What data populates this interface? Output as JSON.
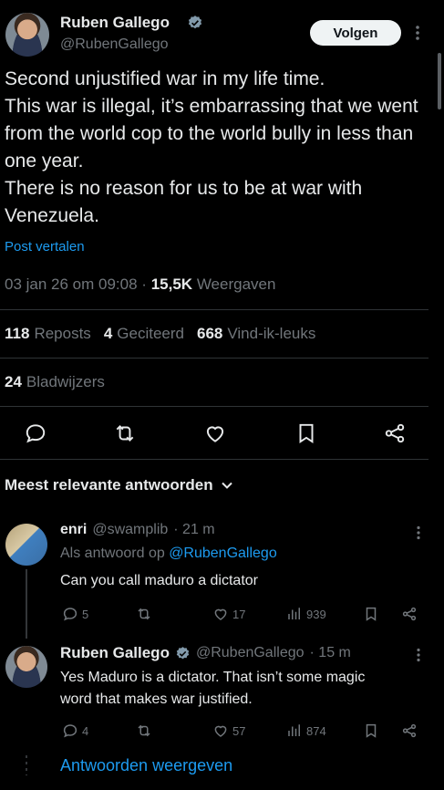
{
  "tweet": {
    "author_name": "Ruben Gallego",
    "author_handle": "@RubenGallego",
    "follow_label": "Volgen",
    "lines": [
      "Second unjustified war in my life time.",
      "This war is illegal, it’s embarrassing that we went from the world cop to the world bully in less than one year.",
      "There is no reason for us to be at war with Venezuela."
    ],
    "translate_label": "Post vertalen",
    "timestamp": "03 jan 26 om 09:08",
    "separator": "·",
    "views_count": "15,5K",
    "views_label": "Weergaven"
  },
  "stats": {
    "reposts_count": "118",
    "reposts_label": "Reposts",
    "quotes_count": "4",
    "quotes_label": "Geciteerd",
    "likes_count": "668",
    "likes_label": "Vind-ik-leuks",
    "bookmarks_count": "24",
    "bookmarks_label": "Bladwijzers"
  },
  "replies_section": {
    "title": "Meest relevante antwoorden"
  },
  "replies": [
    {
      "name": "enri",
      "handle": "@swamplib",
      "time": "· 21 m",
      "reply_to_label": "Als antwoord op",
      "reply_to_handle": "@RubenGallego",
      "text": "Can you call maduro a dictator",
      "reply_count": "5",
      "like_count": "17",
      "view_count": "939"
    },
    {
      "name": "Ruben Gallego",
      "handle": "@RubenGallego",
      "time": "· 15 m",
      "text": "Yes Maduro is a dictator.  That isn’t some magic word that makes war justified.",
      "reply_count": "4",
      "like_count": "57",
      "view_count": "874"
    }
  ],
  "show_replies_label": "Antwoorden weergeven",
  "colors": {
    "background": "#000000",
    "text": "#e7e9ea",
    "muted": "#71767b",
    "link": "#1d9bf0",
    "divider": "#2f3336"
  },
  "icons": [
    "verified-badge-icon",
    "more-icon",
    "reply-icon",
    "repost-icon",
    "like-icon",
    "bookmark-icon",
    "share-icon",
    "views-icon",
    "chevron-down-icon"
  ]
}
